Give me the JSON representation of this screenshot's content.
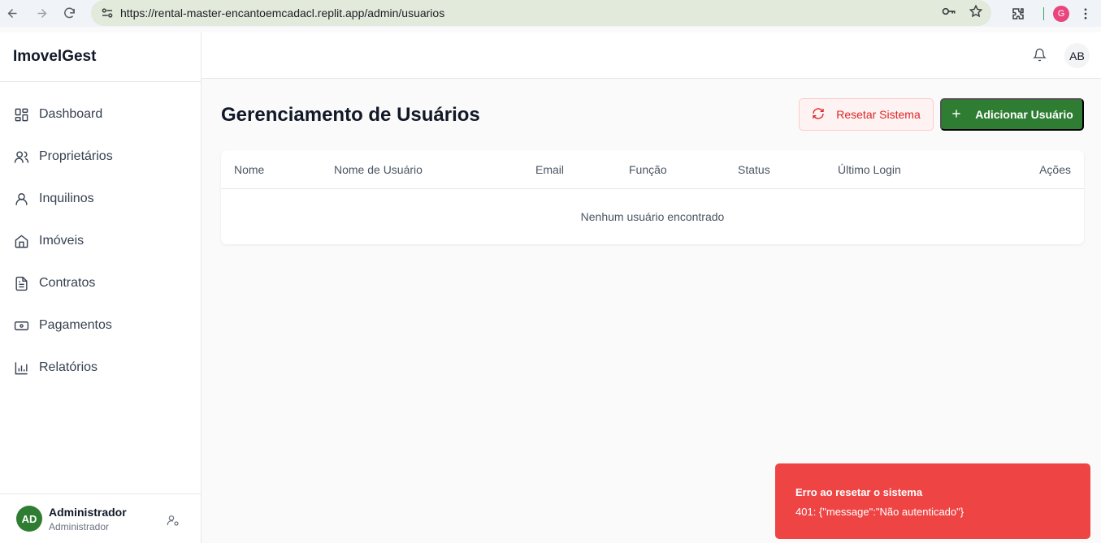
{
  "browser": {
    "url": "https://rental-master-encantoemcadacl.replit.app/admin/usuarios",
    "profile_initial": "G"
  },
  "sidebar": {
    "brand": "ImovelGest",
    "items": [
      {
        "label": "Dashboard",
        "icon": "dashboard-icon"
      },
      {
        "label": "Proprietários",
        "icon": "users-icon"
      },
      {
        "label": "Inquilinos",
        "icon": "user-icon"
      },
      {
        "label": "Imóveis",
        "icon": "home-icon"
      },
      {
        "label": "Contratos",
        "icon": "file-text-icon"
      },
      {
        "label": "Pagamentos",
        "icon": "banknote-icon"
      },
      {
        "label": "Relatórios",
        "icon": "bar-chart-icon"
      }
    ],
    "user": {
      "initials": "AD",
      "name": "Administrador",
      "role": "Administrador"
    }
  },
  "header": {
    "avatar_initials": "AB"
  },
  "main": {
    "title": "Gerenciamento de Usuários",
    "reset_label": "Resetar Sistema",
    "add_label": "Adicionar Usuário",
    "table": {
      "columns": [
        "Nome",
        "Nome de Usuário",
        "Email",
        "Função",
        "Status",
        "Último Login",
        "Ações"
      ],
      "empty_message": "Nenhum usuário encontrado"
    }
  },
  "toast": {
    "title": "Erro ao resetar o sistema",
    "message": "401: {\"message\":\"Não autenticado\"}"
  },
  "colors": {
    "primary": "#2e7d32",
    "danger": "#ef4444",
    "danger_text": "#dc2626"
  }
}
